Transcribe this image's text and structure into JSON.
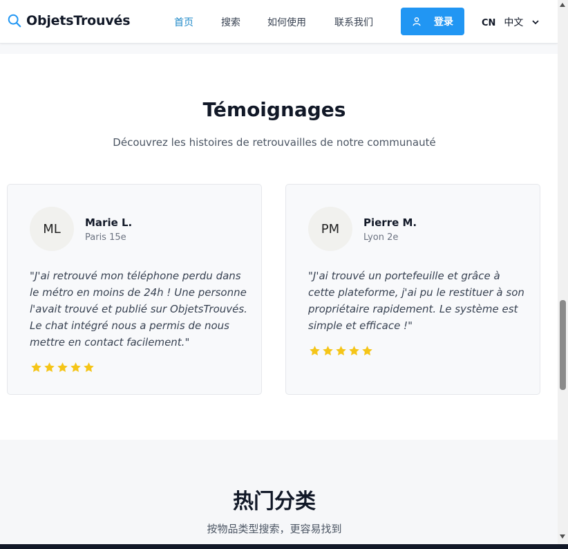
{
  "header": {
    "brand": "ObjetsTrouvés",
    "nav": [
      "首页",
      "搜索",
      "如何使用",
      "联系我们"
    ],
    "login_label": "登录",
    "lang_code": "CN",
    "lang_name": "中文"
  },
  "testimonials": {
    "title": "Témoignages",
    "subtitle": "Découvrez les histoires de retrouvailles de notre communauté",
    "items": [
      {
        "initials": "ML",
        "name": "Marie L.",
        "location": "Paris 15e",
        "quote": "\"J'ai retrouvé mon téléphone perdu dans le métro en moins de 24h ! Une personne l'avait trouvé et publié sur ObjetsTrouvés. Le chat intégré nous a permis de nous mettre en contact facilement.\"",
        "rating": 5
      },
      {
        "initials": "PM",
        "name": "Pierre M.",
        "location": "Lyon 2e",
        "quote": "\"J'ai trouvé un portefeuille et grâce à cette plateforme, j'ai pu le restituer à son propriétaire rapidement. Le système est simple et efficace !\"",
        "rating": 5
      }
    ]
  },
  "categories": {
    "title": "热门分类",
    "subtitle": "按物品类型搜索，更容易找到"
  },
  "colors": {
    "accent": "#2196f3",
    "nav_active": "#1e88c8",
    "star": "#f5c518"
  },
  "icons": [
    "search-icon",
    "user-icon",
    "chevron-down-icon",
    "star-icon"
  ]
}
